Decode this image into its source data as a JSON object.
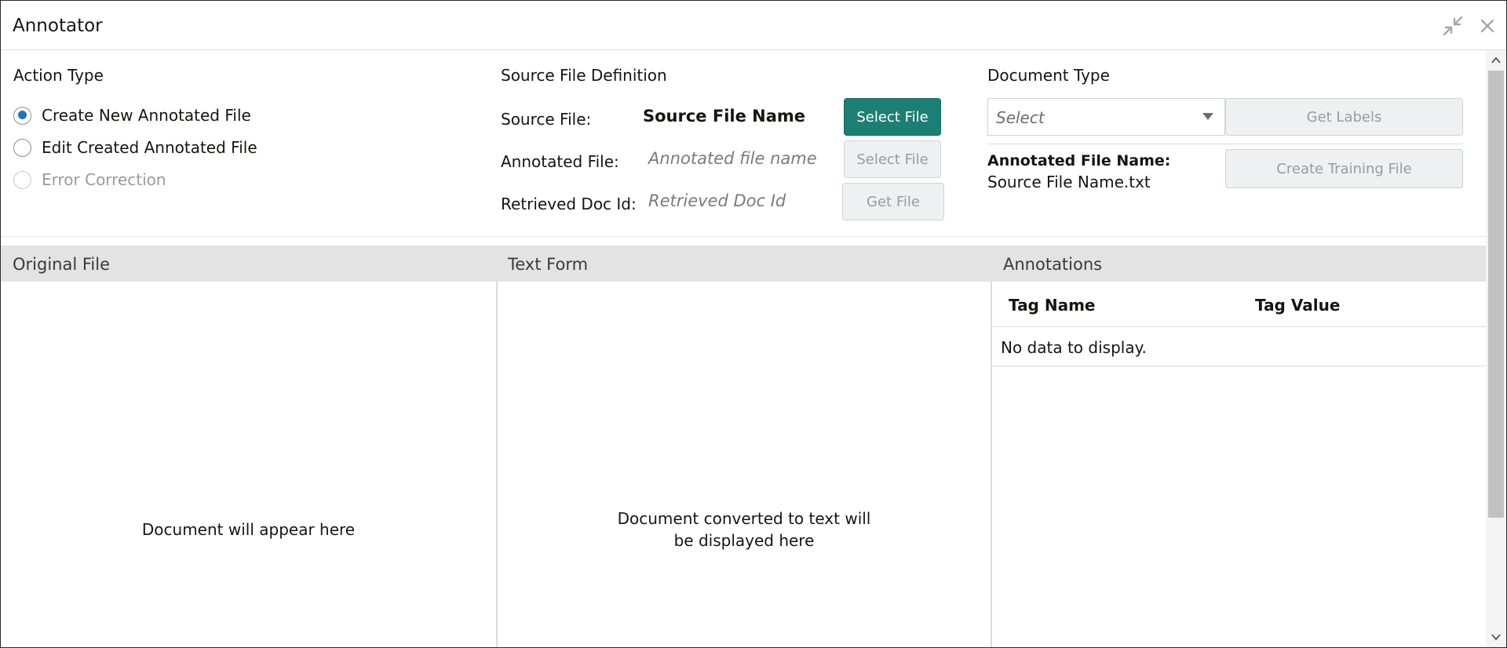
{
  "window": {
    "title": "Annotator",
    "icons": {
      "collapse": "collapse-arrows-icon",
      "close": "close-icon"
    }
  },
  "action_type": {
    "heading": "Action Type",
    "options": [
      {
        "label": "Create New Annotated File",
        "checked": true,
        "disabled": false
      },
      {
        "label": "Edit Created Annotated File",
        "checked": false,
        "disabled": false
      },
      {
        "label": "Error Correction",
        "checked": false,
        "disabled": true
      }
    ]
  },
  "source_file_definition": {
    "heading": "Source File Definition",
    "source_file": {
      "label": "Source File:",
      "value": "Source File Name",
      "button": "Select File"
    },
    "annotated_file": {
      "label": "Annotated File:",
      "placeholder": "Annotated file name",
      "button": "Select File"
    },
    "retrieved_doc": {
      "label": "Retrieved Doc Id:",
      "placeholder": "Retrieved Doc Id",
      "button": "Get File"
    }
  },
  "document_type": {
    "heading": "Document Type",
    "select_placeholder": "Select",
    "get_labels_button": "Get Labels",
    "annotated_file_name_label": "Annotated File Name:",
    "annotated_file_name_value": "Source File Name.txt",
    "create_training_button": "Create Training File"
  },
  "panels": {
    "original_file": {
      "title": "Original File",
      "placeholder": "Document will appear here"
    },
    "text_form": {
      "title": "Text Form",
      "placeholder_line1": "Document converted to text will",
      "placeholder_line2": "be displayed here"
    },
    "annotations": {
      "title": "Annotations",
      "columns": [
        "Tag Name",
        "Tag Value"
      ],
      "empty_text": "No data to display."
    }
  },
  "colors": {
    "primary_button": "#1c7f73",
    "radio_selected": "#1b74c5",
    "panel_header": "#e3e3e3"
  }
}
